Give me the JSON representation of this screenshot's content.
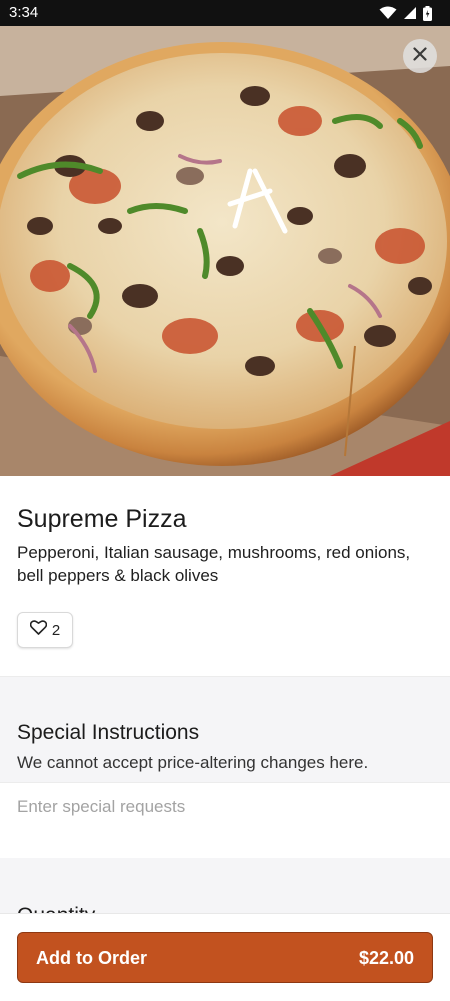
{
  "status_bar": {
    "time": "3:34",
    "icons": [
      "wifi-icon",
      "signal-icon",
      "battery-icon"
    ]
  },
  "item": {
    "image": "pizza-photo",
    "title": "Supreme Pizza",
    "description": "Pepperoni, Italian sausage, mushrooms, red onions, bell peppers & black olives",
    "likes": "2"
  },
  "special_instructions": {
    "title": "Special Instructions",
    "subtitle": "We cannot accept price-altering changes here.",
    "placeholder": "Enter special requests",
    "value": ""
  },
  "quantity": {
    "title": "Quantity"
  },
  "footer": {
    "add_label": "Add to Order",
    "price": "$22.00"
  },
  "colors": {
    "accent": "#c2521f",
    "status_bar": "#111111",
    "section_background": "#f5f5f7",
    "placeholder": "#a3a3a3"
  }
}
